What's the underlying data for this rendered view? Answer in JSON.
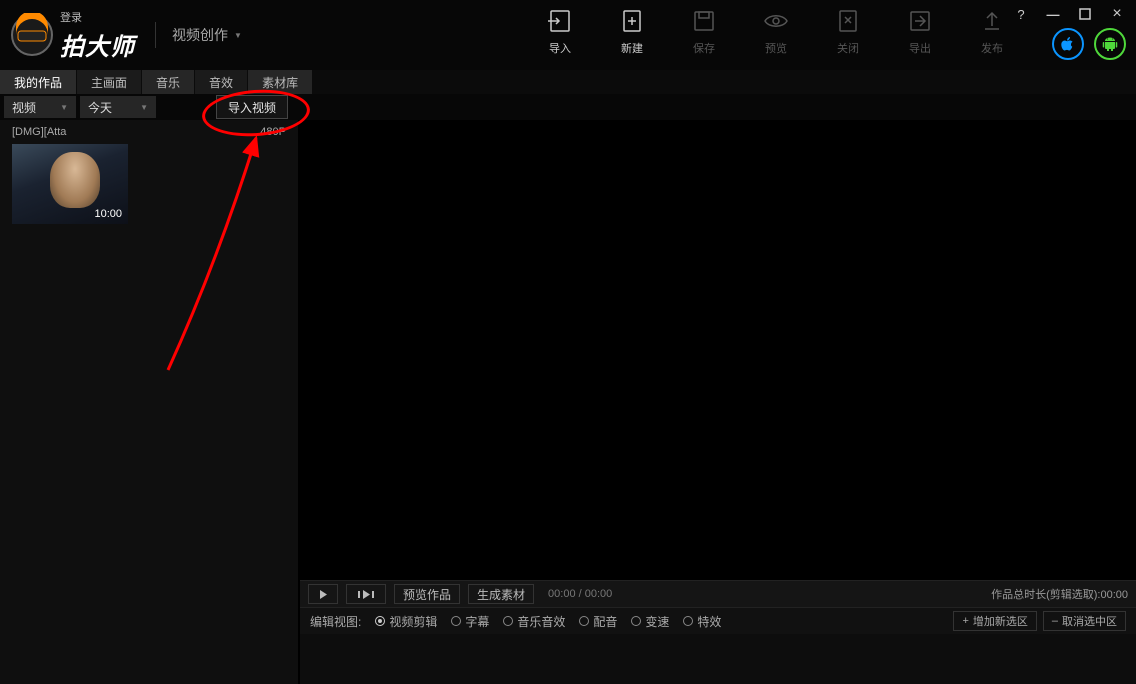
{
  "login": "登录",
  "brand": "拍大师",
  "mode": "视频创作",
  "toolbar": {
    "import": "导入",
    "new": "新建",
    "save": "保存",
    "preview": "预览",
    "close": "关闭",
    "export": "导出",
    "publish": "发布"
  },
  "tabs": {
    "my_works": "我的作品",
    "main_screen": "主画面",
    "music": "音乐",
    "sfx": "音效",
    "library": "素材库"
  },
  "filters": {
    "type": "视频",
    "time": "今天",
    "import_btn": "导入视频"
  },
  "clip": {
    "name": "[DMG][Atta",
    "res": "480P",
    "dur": "10:00"
  },
  "playback": {
    "preview_work": "预览作品",
    "gen_material": "生成素材",
    "time": "00:00 / 00:00",
    "total_label": "作品总时长(剪辑选取):00:00"
  },
  "edit": {
    "label": "编辑视图:",
    "video_edit": "视频剪辑",
    "subtitle": "字幕",
    "music_fx": "音乐音效",
    "dub": "配音",
    "speed": "变速",
    "fx": "特效",
    "add_sel": "增加新选区",
    "cancel_sel": "取消选中区"
  }
}
